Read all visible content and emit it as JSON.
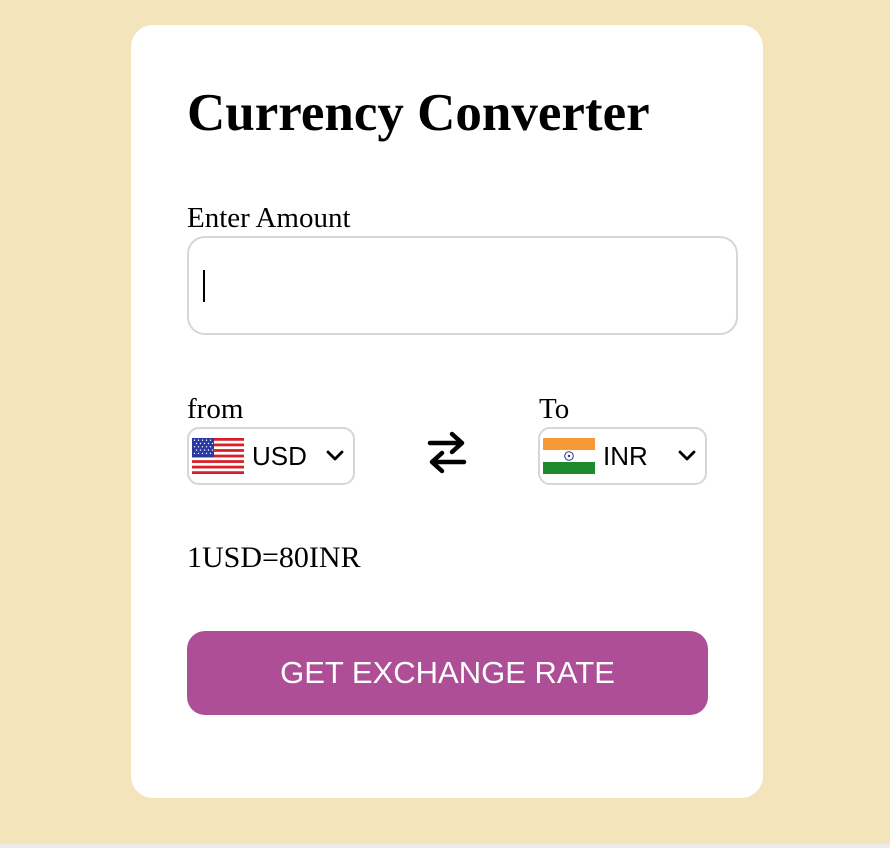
{
  "converter": {
    "title": "Currency Converter",
    "amount_label": "Enter Amount",
    "amount_value": "",
    "from_label": "from",
    "to_label": "To",
    "from_currency": "USD",
    "to_currency": "INR",
    "from_flag_icon": "us-flag-icon",
    "to_flag_icon": "india-flag-icon",
    "swap_icon": "swap-arrows-icon",
    "rate_text": "1USD=80INR",
    "button_label": "GET EXCHANGE RATE"
  },
  "colors": {
    "background": "#f3e4bb",
    "card": "#ffffff",
    "button": "#ae4e96",
    "button_text": "#ffffff",
    "border": "#d6d6d6"
  }
}
